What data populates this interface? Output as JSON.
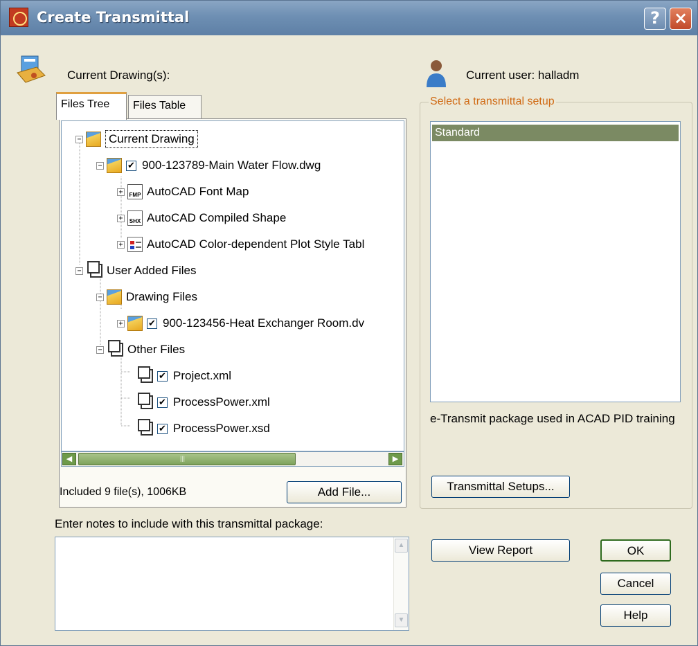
{
  "window": {
    "title": "Create Transmittal",
    "help_label": "?",
    "close_label": "×"
  },
  "header": {
    "current_drawings_label": "Current Drawing(s):",
    "current_user_label": "Current user: halladm"
  },
  "tabs": [
    {
      "label": "Files Tree",
      "active": true
    },
    {
      "label": "Files Table",
      "active": false
    }
  ],
  "tree": {
    "nodes": [
      {
        "label": "Current Drawing",
        "icon": "folder-drawing-icon",
        "expander": "−"
      },
      {
        "label": "900-123789-Main Water Flow.dwg",
        "icon": "folder-drawing-icon",
        "expander": "−",
        "checked": true
      },
      {
        "label": "AutoCAD Font Map",
        "icon": "font-map-icon",
        "icon_text": "FMP",
        "expander": "+"
      },
      {
        "label": "AutoCAD Compiled Shape",
        "icon": "compiled-shape-icon",
        "icon_text": "SHX",
        "expander": "+"
      },
      {
        "label": "AutoCAD Color-dependent Plot Style Tabl",
        "icon": "plot-style-icon",
        "expander": "+"
      },
      {
        "label": "User Added Files",
        "icon": "files-icon",
        "expander": "−"
      },
      {
        "label": "Drawing Files",
        "icon": "folder-drawing-icon",
        "expander": "−"
      },
      {
        "label": "900-123456-Heat Exchanger Room.dv",
        "icon": "folder-drawing-icon",
        "expander": "+",
        "checked": true
      },
      {
        "label": "Other Files",
        "icon": "files-icon",
        "expander": "−"
      },
      {
        "label": "Project.xml",
        "icon": "files-icon",
        "checked": true
      },
      {
        "label": "ProcessPower.xml",
        "icon": "files-icon",
        "checked": true
      },
      {
        "label": "ProcessPower.xsd",
        "icon": "files-icon",
        "checked": true
      }
    ],
    "check_mark": "✔",
    "scroll_left": "◀",
    "scroll_right": "▶",
    "scroll_grip": "|||"
  },
  "summary": {
    "included_text": "Included 9 file(s), 1006KB",
    "add_file_label": "Add File..."
  },
  "setup": {
    "group_label": "Select a transmittal setup",
    "items": [
      "Standard"
    ],
    "selected": "Standard",
    "description": "e-Transmit package used in ACAD PID training",
    "setups_button_label": "Transmittal Setups..."
  },
  "notes": {
    "label": "Enter notes to include with this transmittal package:",
    "value": "",
    "scroll_up": "▲",
    "scroll_down": "▼"
  },
  "actions": {
    "view_report_label": "View Report",
    "ok_label": "OK",
    "cancel_label": "Cancel",
    "help_label": "Help"
  },
  "colors": {
    "title_bar": "#6e8fb3",
    "dialog_bg": "#ece9d8",
    "group_label": "#d06a14",
    "selection": "#7b8a63",
    "scroll_thumb": "#7ea35c"
  }
}
